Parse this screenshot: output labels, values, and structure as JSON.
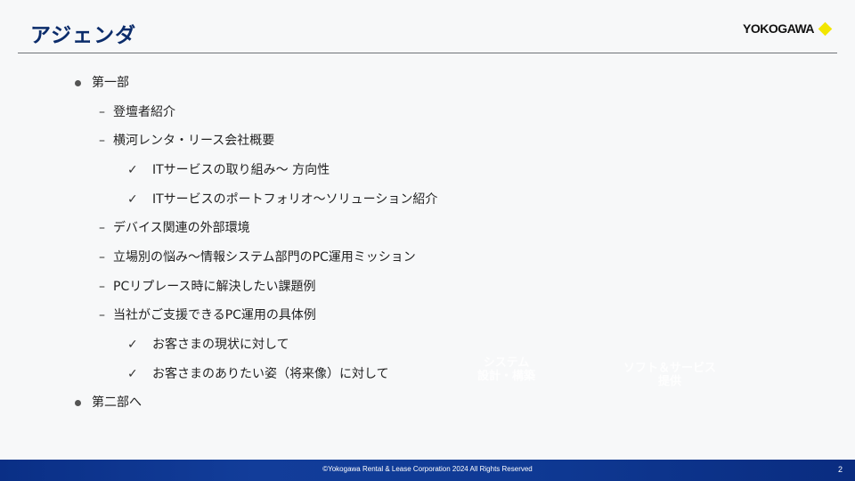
{
  "header": {
    "title": "アジェンダ",
    "logo_text": "YOKOGAWA",
    "logo_accent": "#f2e600"
  },
  "agenda": {
    "items": [
      {
        "level": 1,
        "marker": "bullet",
        "text": "第一部"
      },
      {
        "level": 2,
        "marker": "–",
        "text": "登壇者紹介"
      },
      {
        "level": 2,
        "marker": "–",
        "text": "横河レンタ・リース会社概要"
      },
      {
        "level": 3,
        "marker": "✓",
        "text": "ITサービスの取り組み～ 方向性"
      },
      {
        "level": 3,
        "marker": "✓",
        "text": "ITサービスのポートフォリオ～ソリューション紹介"
      },
      {
        "level": 2,
        "marker": "–",
        "text": "デバイス関連の外部環境"
      },
      {
        "level": 2,
        "marker": "–",
        "text": "立場別の悩み～情報システム部門のPC運用ミッション"
      },
      {
        "level": 2,
        "marker": "–",
        "text": "PCリプレース時に解決したい課題例"
      },
      {
        "level": 2,
        "marker": "–",
        "text": "当社がご支援できるPC運用の具体例"
      },
      {
        "level": 3,
        "marker": "✓",
        "text": "お客さまの現状に対して"
      },
      {
        "level": 3,
        "marker": "✓",
        "text": "お客さまのありたい姿（将来像）に対して"
      },
      {
        "level": 1,
        "marker": "bullet",
        "text": "第二部へ"
      }
    ]
  },
  "ghost_labels": {
    "system": "システム\n設計・構築",
    "software": "ソフト＆サービス\n提供"
  },
  "footer": {
    "copyright": "©Yokogawa Rental & Lease Corporation 2024 All Rights Reserved",
    "page_number": "2"
  },
  "colors": {
    "title": "#0b2c6b",
    "footer_bar": "#0f3a95"
  }
}
